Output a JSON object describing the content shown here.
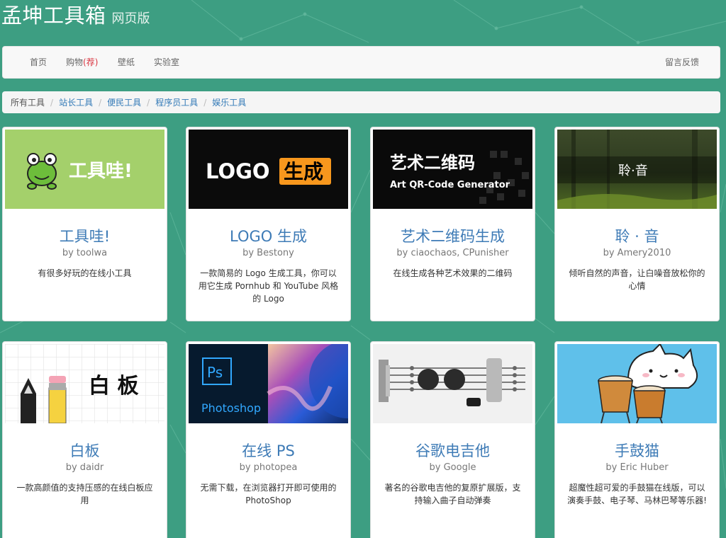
{
  "site": {
    "title": "孟坤工具箱",
    "subtitle": "网页版"
  },
  "nav": {
    "home": "首页",
    "shop": "购物",
    "shop_hot": "(荐)",
    "wallpaper": "壁纸",
    "lab": "实验室",
    "feedback": "留言反馈"
  },
  "breadcrumb": [
    "所有工具",
    "站长工具",
    "便民工具",
    "程序员工具",
    "娱乐工具"
  ],
  "tools": [
    {
      "title": "工具哇!",
      "author": "by toolwa",
      "desc": "有很多好玩的在线小工具",
      "thumb_text": "工具哇!"
    },
    {
      "title": "LOGO 生成",
      "author": "by Bestony",
      "desc": "一款简易的 Logo 生成工具，你可以用它生成 Pornhub 和 YouTube 风格的 Logo",
      "thumb_text_left": "LOGO",
      "thumb_text_right": "生成"
    },
    {
      "title": "艺术二维码生成",
      "author": "by ciaochaos, CPunisher",
      "desc": "在线生成各种艺术效果的二维码",
      "thumb_text": "艺术二维码",
      "thumb_subtext": "Art QR-Code Generator"
    },
    {
      "title": "聆 · 音",
      "author": "by Amery2010",
      "desc": "倾听自然的声音，让白噪音放松你的心情",
      "thumb_text": "聆·音"
    },
    {
      "title": "白板",
      "author": "by daidr",
      "desc": "一款高颜值的支持压感的在线白板应用",
      "thumb_text": "白 板"
    },
    {
      "title": "在线 PS",
      "author": "by photopea",
      "desc": "无需下载，在浏览器打开即可使用的 PhotoShop",
      "thumb_text": "Photoshop",
      "thumb_badge": "Ps"
    },
    {
      "title": "谷歌电吉他",
      "author": "by Google",
      "desc": "著名的谷歌电吉他的复原扩展版，支持输入曲子自动弹奏",
      "thumb_text": ""
    },
    {
      "title": "手鼓猫",
      "author": "by Eric Huber",
      "desc": "超魔性超可爱的手鼓猫在线版，可以演奏手鼓、电子琴、马林巴琴等乐器!",
      "thumb_text": ""
    }
  ],
  "colors": {
    "background": "#3d9e82",
    "title_blue": "#3e7bb6",
    "hot_red": "#d9333f"
  }
}
